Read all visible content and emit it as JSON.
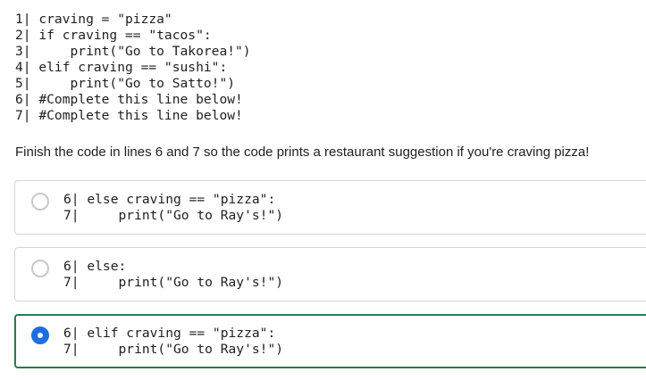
{
  "question": {
    "code_lines": [
      "1| craving = \"pizza\"",
      "2| if craving == \"tacos\":",
      "3|     print(\"Go to Takorea!\")",
      "4| elif craving == \"sushi\":",
      "5|     print(\"Go to Satto!\")",
      "6| #Complete this line below!",
      "7| #Complete this line below!"
    ],
    "prompt": "Finish the code in lines 6 and 7 so the code prints a restaurant suggestion if you're craving pizza!"
  },
  "options": [
    {
      "selected": false,
      "lines": [
        "6| else craving == \"pizza\":",
        "7|     print(\"Go to Ray's!\")"
      ]
    },
    {
      "selected": false,
      "lines": [
        "6| else:",
        "7|     print(\"Go to Ray's!\")"
      ]
    },
    {
      "selected": true,
      "lines": [
        "6| elif craving == \"pizza\":",
        "7|     print(\"Go to Ray's!\")"
      ]
    }
  ],
  "colors": {
    "selected_border": "#2c7a4f",
    "radio_selected": "#1f6fe0",
    "option_border": "#d6d6d6"
  }
}
